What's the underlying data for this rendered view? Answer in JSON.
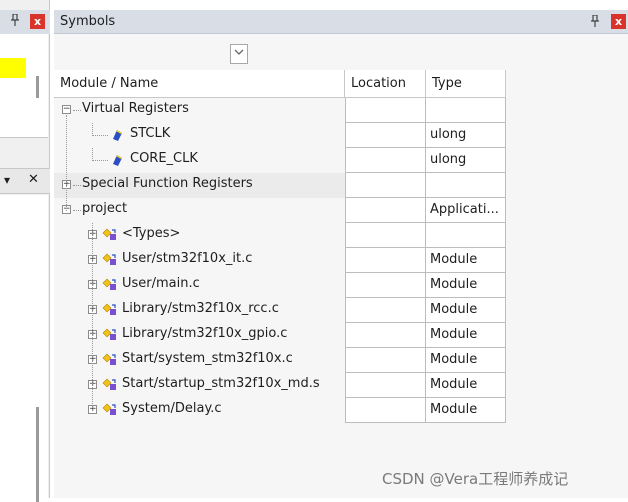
{
  "left_panel": {
    "pin_label": "ᵖ",
    "close_label": "x",
    "dropdown_label": "▾",
    "second_close_label": "✕"
  },
  "symbols": {
    "title": "Symbols",
    "pin_label": "ᵖ",
    "close_label": "x",
    "columns": {
      "name": "Module / Name",
      "location": "Location",
      "type": "Type"
    },
    "rows": [
      {
        "name": "Virtual Registers",
        "location": "",
        "type": "",
        "expander": "⊟",
        "icon": "none",
        "level": 0
      },
      {
        "name": "STCLK",
        "location": "",
        "type": "ulong",
        "expander": "",
        "icon": "register-icon",
        "level": 2
      },
      {
        "name": "CORE_CLK",
        "location": "",
        "type": "ulong",
        "expander": "",
        "icon": "register-icon",
        "level": 2
      },
      {
        "name": "Special Function Registers",
        "location": "",
        "type": "",
        "expander": "⊞",
        "icon": "none",
        "level": 0
      },
      {
        "name": "project",
        "location": "",
        "type": "Applicati...",
        "expander": "⊟",
        "icon": "none",
        "level": 0
      },
      {
        "name": "<Types>",
        "location": "",
        "type": "",
        "expander": "⊞",
        "icon": "module-icon",
        "level": 1
      },
      {
        "name": "User/stm32f10x_it.c",
        "location": "",
        "type": "Module",
        "expander": "⊞",
        "icon": "module-icon",
        "level": 1
      },
      {
        "name": "User/main.c",
        "location": "",
        "type": "Module",
        "expander": "⊞",
        "icon": "module-icon",
        "level": 1
      },
      {
        "name": "Library/stm32f10x_rcc.c",
        "location": "",
        "type": "Module",
        "expander": "⊞",
        "icon": "module-icon",
        "level": 1
      },
      {
        "name": "Library/stm32f10x_gpio.c",
        "location": "",
        "type": "Module",
        "expander": "⊞",
        "icon": "module-icon",
        "level": 1
      },
      {
        "name": "Start/system_stm32f10x.c",
        "location": "",
        "type": "Module",
        "expander": "⊞",
        "icon": "module-icon",
        "level": 1
      },
      {
        "name": "Start/startup_stm32f10x_md.s",
        "location": "",
        "type": "Module",
        "expander": "⊞",
        "icon": "module-icon",
        "level": 1
      },
      {
        "name": "System/Delay.c",
        "location": "",
        "type": "Module",
        "expander": "⊞",
        "icon": "module-icon",
        "level": 1
      }
    ]
  },
  "watermark": "CSDN @Vera工程师养成记"
}
